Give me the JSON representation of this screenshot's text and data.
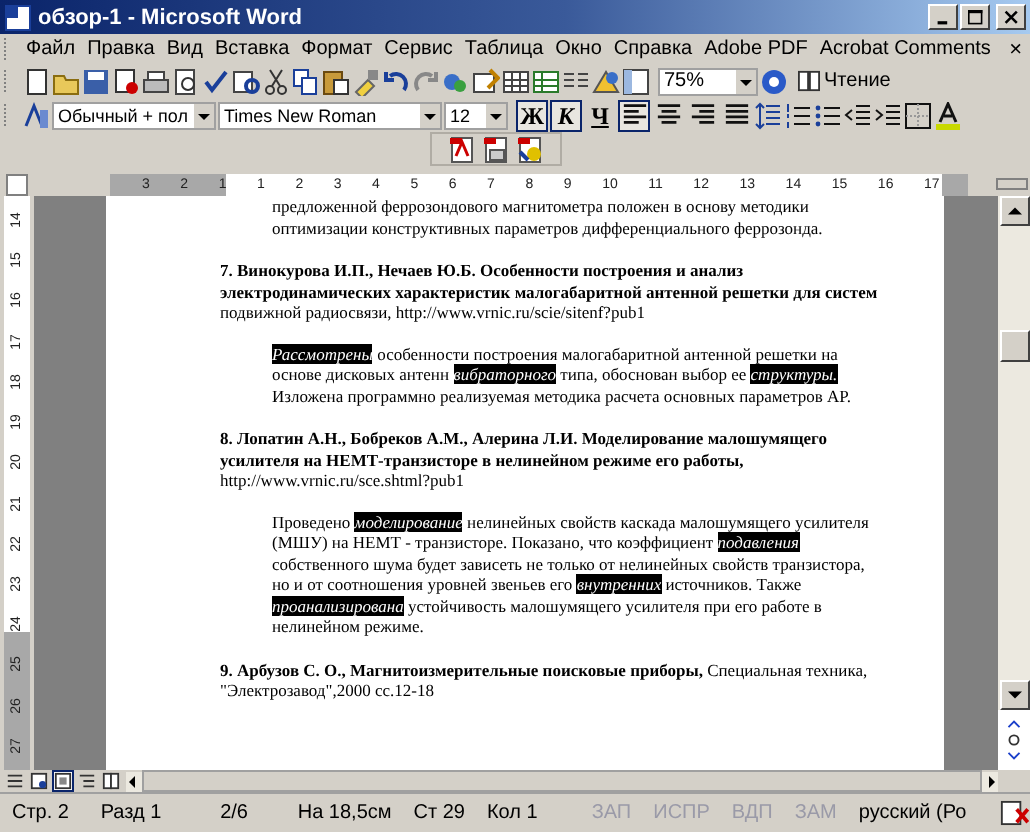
{
  "window": {
    "title": "обзор-1 - Microsoft Word"
  },
  "menu": [
    "Файл",
    "Правка",
    "Вид",
    "Вставка",
    "Формат",
    "Сервис",
    "Таблица",
    "Окно",
    "Справка",
    "Adobe PDF",
    "Acrobat Comments"
  ],
  "menu_close": "×",
  "standard_toolbar": {
    "zoom": "75%",
    "reading": "Чтение"
  },
  "formatting_toolbar": {
    "style": "Обычный + пол",
    "font": "Times New Roman",
    "size": "12",
    "format_buttons": [
      {
        "label": "Ж",
        "pressed": true
      },
      {
        "label": "К",
        "pressed": true
      },
      {
        "label": "Ч",
        "pressed": false
      }
    ],
    "alignment": [
      {
        "selected": true
      },
      {
        "selected": false
      },
      {
        "selected": false
      },
      {
        "selected": false
      }
    ]
  },
  "ruler": {
    "labels": [
      "3",
      "2",
      "1",
      "1",
      "2",
      "3",
      "4",
      "5",
      "6",
      "7",
      "8",
      "9",
      "10",
      "11",
      "12",
      "13",
      "14",
      "15",
      "16",
      "17"
    ]
  },
  "vertical_ruler": {
    "labels": [
      "14",
      "15",
      "16",
      "17",
      "18",
      "19",
      "20",
      "21",
      "22",
      "23",
      "24",
      "25",
      "26",
      "27"
    ]
  },
  "document": {
    "lead_lines": [
      "предложенной феррозондового магнитометра положен в основу методики",
      "оптимизации конструктивных параметров дифференциального феррозонда."
    ],
    "entries": [
      {
        "title": "7. Винокурова И.П., Нечаев Ю.Б. Особенности построения и анализ электродинамических характеристик малогабаритной антенной решетки для систем",
        "rest": "подвижной радиосвязи, http://www.vrnic.ru/scie/sitenf?pub1",
        "abstract": [
          {
            "text": "Рассмотрены",
            "highlighted": true
          },
          {
            "text": " особенности построения малогабаритной антенной решетки на основе дисковых антенн ",
            "highlighted": false
          },
          {
            "text": "вибраторного",
            "highlighted": true
          },
          {
            "text": " типа, обоснован выбор ее ",
            "highlighted": false
          },
          {
            "text": "структуры.",
            "highlighted": true
          },
          {
            "text": " Изложена программно реализуемая методика расчета основных параметров АР.",
            "highlighted": false
          }
        ]
      },
      {
        "title": "8. Лопатин А.Н., Бобреков А.М., Алерина Л.И. Моделирование малошумящего усилителя на НЕМТ-транзисторе в нелинейном режиме его работы,",
        "rest": "http://www.vrnic.ru/sce.shtml?pub1",
        "abstract": [
          {
            "text": "Проведено ",
            "highlighted": false
          },
          {
            "text": "моделирование",
            "highlighted": true
          },
          {
            "text": " нелинейных свойств каскада малошумящего усилителя (МШУ) на НЕМТ - транзисторе. Показано, что коэффициент ",
            "highlighted": false
          },
          {
            "text": "подавления",
            "highlighted": true
          },
          {
            "text": " собственного шума будет зависеть не только от нелинейных свойств транзистора, но и от соотношения уровней звеньев его ",
            "highlighted": false
          },
          {
            "text": "внутренних",
            "highlighted": true
          },
          {
            "text": " источников. Также ",
            "highlighted": false
          },
          {
            "text": "проанализирована",
            "highlighted": true
          },
          {
            "text": " устойчивость малошумящего усилителя при его работе в нелинейном режиме.",
            "highlighted": false
          }
        ]
      },
      {
        "title": "9. Арбузов С. О., Магнитоизмерительные поисковые приборы,",
        "rest": "Специальная техника, \"Электрозавод\",2000 сс.12-18"
      }
    ]
  },
  "status_bar": [
    {
      "text": "Стр. 2",
      "disabled": false
    },
    {
      "text": "Разд 1",
      "disabled": false
    },
    {
      "text": "2/6",
      "disabled": false
    },
    {
      "text": "На 18,5см",
      "disabled": false
    },
    {
      "text": "Ст 29",
      "disabled": false
    },
    {
      "text": "Кол 1",
      "disabled": false
    },
    {
      "text": "ЗАП",
      "disabled": true
    },
    {
      "text": "ИСПР",
      "disabled": true
    },
    {
      "text": "ВДП",
      "disabled": true
    },
    {
      "text": "ЗАМ",
      "disabled": true
    },
    {
      "text": "русский (Ро",
      "disabled": false
    }
  ]
}
